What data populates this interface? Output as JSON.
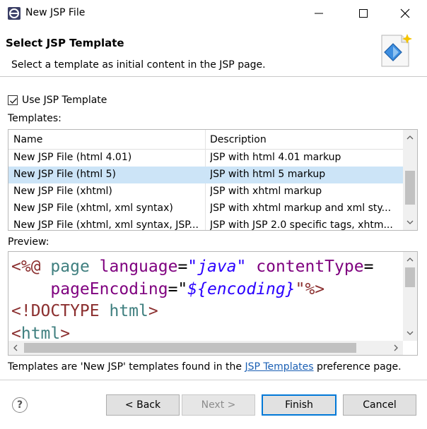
{
  "window": {
    "title": "New JSP File"
  },
  "header": {
    "title": "Select JSP Template",
    "description": "Select a template as initial content in the JSP page."
  },
  "use_template": {
    "label": "Use JSP Template",
    "checked": true
  },
  "templates_label": "Templates:",
  "table": {
    "columns": [
      "Name",
      "Description"
    ],
    "rows": [
      {
        "name": "New JSP File (html 4.01)",
        "description": "JSP with html 4.01 markup",
        "selected": false
      },
      {
        "name": "New JSP File (html 5)",
        "description": "JSP with html 5 markup",
        "selected": true
      },
      {
        "name": "New JSP File (xhtml)",
        "description": "JSP with xhtml markup",
        "selected": false
      },
      {
        "name": "New JSP File (xhtml, xml syntax)",
        "description": "JSP with xhtml markup and xml sty...",
        "selected": false
      },
      {
        "name": "New JSP File (xhtml, xml syntax, JSP...",
        "description": "JSP with JSP 2.0 specific tags, xhtm...",
        "selected": false
      }
    ]
  },
  "preview_label": "Preview:",
  "preview": {
    "line1": {
      "open": "<%@",
      "kw": "page",
      "attr1": "language",
      "eq1": "=",
      "val1": "\"java\"",
      "attr2": "contentType",
      "eq2": "="
    },
    "line2": {
      "attr": "pageEncoding",
      "eq": "=\"",
      "val": "${encoding}",
      "close": "\"%>"
    },
    "line3": {
      "open": "<!DOCTYPE",
      "kw": "html",
      "close": ">"
    },
    "line4": {
      "open": "<",
      "kw": "html",
      "close": ">"
    }
  },
  "footer": {
    "text_before": "Templates are 'New JSP' templates found in the ",
    "link": "JSP Templates",
    "text_after": " preference page."
  },
  "buttons": {
    "help": "?",
    "back": "< Back",
    "next": "Next >",
    "finish": "Finish",
    "cancel": "Cancel"
  },
  "colors": {
    "selection": "#cce4f7",
    "accent": "#0078d7",
    "link": "#1a5fb4"
  }
}
